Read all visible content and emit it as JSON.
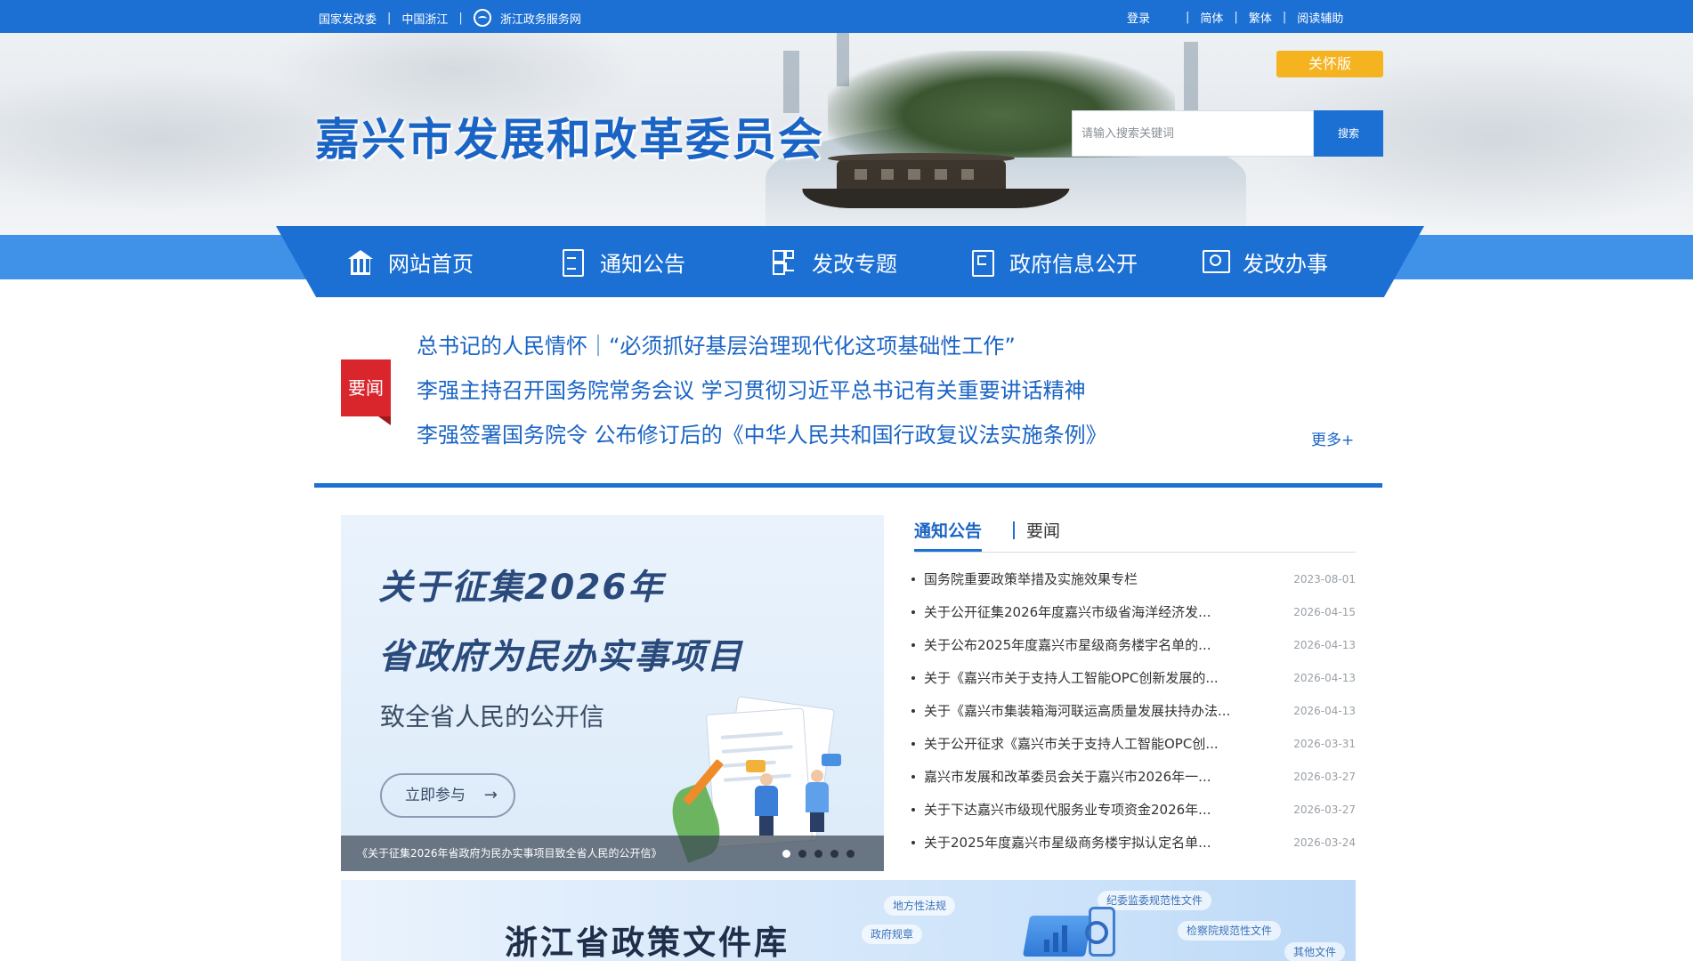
{
  "topbar": {
    "links_left": [
      "国家发改委",
      "中国浙江",
      "浙江政务服务网"
    ],
    "links_right": [
      "登录",
      "简体",
      "繁体",
      "阅读辅助"
    ]
  },
  "header": {
    "site_title": "嘉兴市发展和改革委员会",
    "care_button": "关怀版",
    "search_placeholder": "请输入搜索关键词",
    "search_button": "搜索"
  },
  "nav": {
    "items": [
      {
        "label": "网站首页",
        "icon": "home-icon"
      },
      {
        "label": "通知公告",
        "icon": "document-icon"
      },
      {
        "label": "发改专题",
        "icon": "grid-icon"
      },
      {
        "label": "政府信息公开",
        "icon": "info-disclosure-icon"
      },
      {
        "label": "发改办事",
        "icon": "service-screen-icon"
      }
    ]
  },
  "news": {
    "badge": "要闻",
    "headlines": [
      "总书记的人民情怀｜“必须抓好基层治理现代化这项基础性工作”",
      "李强主持召开国务院常务会议 学习贯彻习近平总书记有关重要讲话精神",
      "李强签署国务院令 公布修订后的《中华人民共和国行政复议法实施条例》"
    ],
    "more": "更多+"
  },
  "banner": {
    "title_line1": "关于征集2026年",
    "title_line2": "省政府为民办实事项目",
    "subtitle": "致全省人民的公开信",
    "button": "立即参与",
    "caption": "《关于征集2026年省政府为民办实事项目致全省人民的公开信》",
    "slide_count": 5,
    "active_slide": 1
  },
  "notices": {
    "tab_active": "通知公告",
    "tab_inactive": "要闻",
    "items": [
      {
        "title": "国务院重要政策举措及实施效果专栏",
        "date": "2023-08-01"
      },
      {
        "title": "关于公开征集2026年度嘉兴市级省海洋经济发...",
        "date": "2026-04-15"
      },
      {
        "title": "关于公布2025年度嘉兴市星级商务楼宇名单的...",
        "date": "2026-04-13"
      },
      {
        "title": "关于《嘉兴市关于支持人工智能OPC创新发展的...",
        "date": "2026-04-13"
      },
      {
        "title": "关于《嘉兴市集装箱海河联运高质量发展扶持办法...",
        "date": "2026-04-13"
      },
      {
        "title": "关于公开征求《嘉兴市关于支持人工智能OPC创...",
        "date": "2026-03-31"
      },
      {
        "title": "嘉兴市发展和改革委员会关于嘉兴市2026年一...",
        "date": "2026-03-27"
      },
      {
        "title": "关于下达嘉兴市级现代服务业专项资金2026年...",
        "date": "2026-03-27"
      },
      {
        "title": "关于2025年度嘉兴市星级商务楼宇拟认定名单...",
        "date": "2026-03-24"
      }
    ]
  },
  "policy": {
    "title": "浙江省政策文件库",
    "tags": [
      "地方性法规",
      "纪委监委规范性文件",
      "政府规章",
      "检察院规范性文件",
      "其他文件"
    ]
  },
  "colors": {
    "brand_blue": "#1c70d4",
    "title_blue": "#1a64c5",
    "care_orange": "#f5b320",
    "news_red": "#d9262c"
  }
}
